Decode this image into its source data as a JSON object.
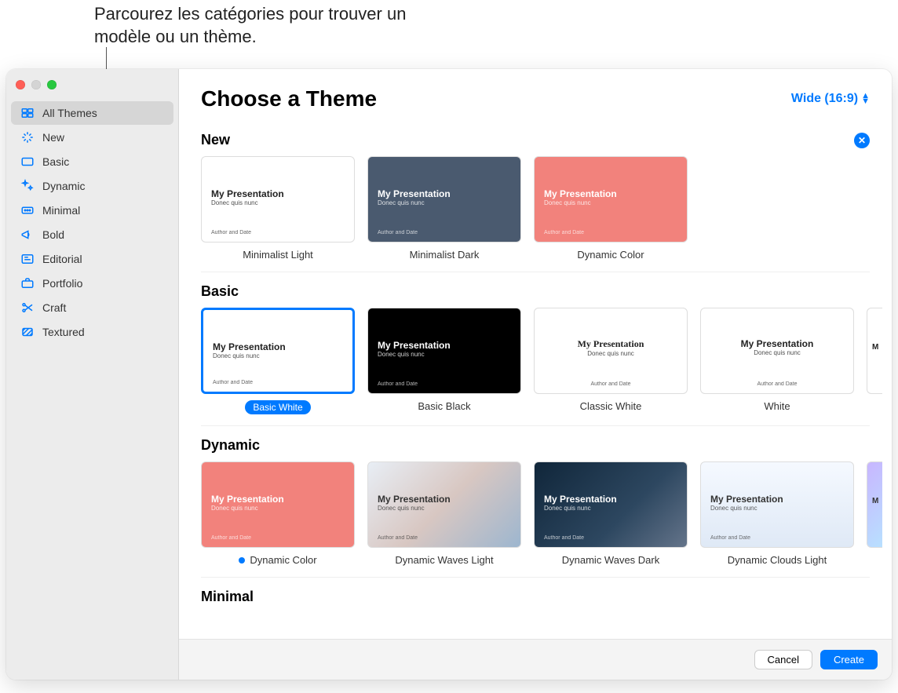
{
  "callout": "Parcourez les catégories pour trouver un modèle ou un thème.",
  "sidebar": {
    "items": [
      {
        "label": "All Themes",
        "icon": "grid-icon"
      },
      {
        "label": "New",
        "icon": "sparkle-icon"
      },
      {
        "label": "Basic",
        "icon": "rectangle-icon"
      },
      {
        "label": "Dynamic",
        "icon": "stars-icon"
      },
      {
        "label": "Minimal",
        "icon": "dots-icon"
      },
      {
        "label": "Bold",
        "icon": "megaphone-icon"
      },
      {
        "label": "Editorial",
        "icon": "newspaper-icon"
      },
      {
        "label": "Portfolio",
        "icon": "briefcase-icon"
      },
      {
        "label": "Craft",
        "icon": "scissors-icon"
      },
      {
        "label": "Textured",
        "icon": "texture-icon"
      }
    ],
    "selected_index": 0
  },
  "header": {
    "title": "Choose a Theme",
    "aspect_label": "Wide (16:9)"
  },
  "preview": {
    "title": "My Presentation",
    "subtitle": "Donec quis nunc",
    "author": "Author and Date"
  },
  "sections": [
    {
      "title": "New",
      "closable": true,
      "themes": [
        {
          "label": "Minimalist Light",
          "bg": "bg-white"
        },
        {
          "label": "Minimalist Dark",
          "bg": "bg-slate"
        },
        {
          "label": "Dynamic Color",
          "bg": "bg-coral"
        }
      ]
    },
    {
      "title": "Basic",
      "closable": false,
      "overflow": true,
      "themes": [
        {
          "label": "Basic White",
          "bg": "bg-white",
          "selected": true,
          "pill": true
        },
        {
          "label": "Basic Black",
          "bg": "bg-black"
        },
        {
          "label": "Classic White",
          "bg": "bg-white",
          "centered": true,
          "serif": true
        },
        {
          "label": "White",
          "bg": "bg-white",
          "centered": true
        }
      ]
    },
    {
      "title": "Dynamic",
      "closable": false,
      "overflow": true,
      "overflow_bg": "bg-purple-grad",
      "themes": [
        {
          "label": "Dynamic Color",
          "bg": "bg-coral",
          "bluedot": true
        },
        {
          "label": "Dynamic Waves Light",
          "bg": "bg-waves-light"
        },
        {
          "label": "Dynamic Waves Dark",
          "bg": "bg-waves-dark"
        },
        {
          "label": "Dynamic Clouds Light",
          "bg": "bg-clouds"
        }
      ]
    },
    {
      "title": "Minimal",
      "closable": false,
      "themes": []
    }
  ],
  "footer": {
    "cancel": "Cancel",
    "create": "Create"
  }
}
